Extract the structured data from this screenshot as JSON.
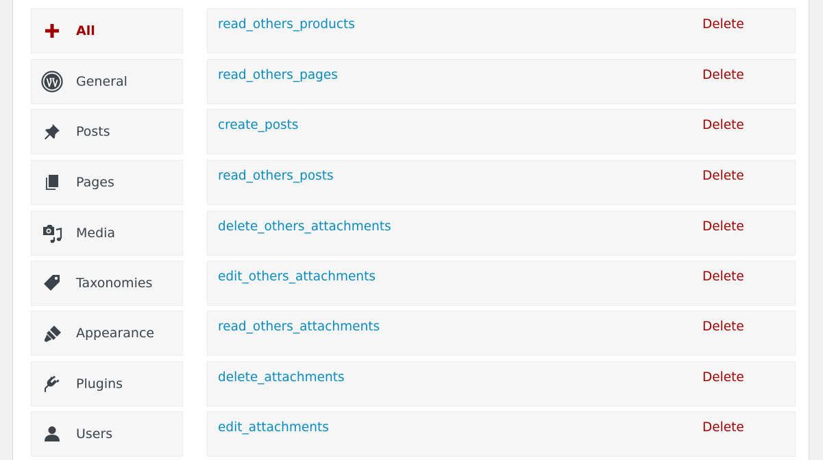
{
  "sidebar": {
    "items": [
      {
        "label": "All",
        "icon": "plus-icon",
        "active": true
      },
      {
        "label": "General",
        "icon": "wordpress-icon"
      },
      {
        "label": "Posts",
        "icon": "pushpin-icon"
      },
      {
        "label": "Pages",
        "icon": "pages-icon"
      },
      {
        "label": "Media",
        "icon": "media-icon"
      },
      {
        "label": "Taxonomies",
        "icon": "tag-icon"
      },
      {
        "label": "Appearance",
        "icon": "paintbrush-icon"
      },
      {
        "label": "Plugins",
        "icon": "plugin-icon"
      },
      {
        "label": "Users",
        "icon": "user-icon"
      }
    ]
  },
  "capabilities": {
    "delete_label": "Delete",
    "rows": [
      {
        "name": "read_others_products"
      },
      {
        "name": "read_others_pages"
      },
      {
        "name": "create_posts"
      },
      {
        "name": "read_others_posts"
      },
      {
        "name": "delete_others_attachments"
      },
      {
        "name": "edit_others_attachments"
      },
      {
        "name": "read_others_attachments"
      },
      {
        "name": "delete_attachments"
      },
      {
        "name": "edit_attachments"
      }
    ]
  },
  "colors": {
    "link": "#0a8bc0",
    "delete": "#a00000",
    "active": "#a00000",
    "icon": "#3c434a"
  }
}
